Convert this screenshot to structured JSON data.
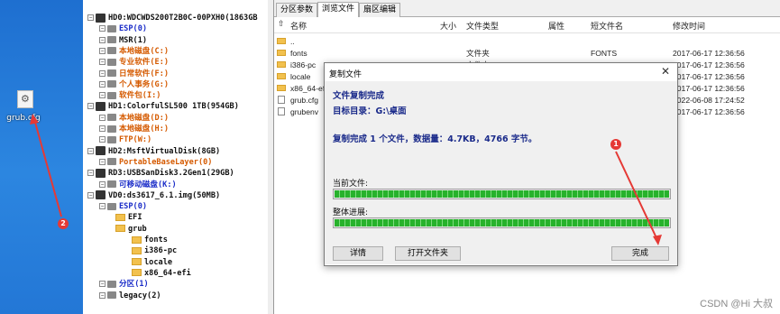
{
  "desktop": {
    "icon_label": "grub.cfg"
  },
  "tree": [
    {
      "label": "HD0:WDCWDS200T2B0C-00PXH0(1863GB",
      "color": "black",
      "level": 0,
      "kind": "disk"
    },
    {
      "label": "ESP(0)",
      "color": "blue",
      "level": 1,
      "kind": "part"
    },
    {
      "label": "MSR(1)",
      "color": "black",
      "level": 1,
      "kind": "part"
    },
    {
      "label": "本地磁盘(C:)",
      "color": "orange",
      "level": 1,
      "kind": "part"
    },
    {
      "label": "专业软件(E:)",
      "color": "orange",
      "level": 1,
      "kind": "part"
    },
    {
      "label": "日常软件(F:)",
      "color": "orange",
      "level": 1,
      "kind": "part"
    },
    {
      "label": "个人事务(G:)",
      "color": "orange",
      "level": 1,
      "kind": "part"
    },
    {
      "label": "软件包(I:)",
      "color": "orange",
      "level": 1,
      "kind": "part"
    },
    {
      "label": "HD1:ColorfulSL500 1TB(954GB)",
      "color": "black",
      "level": 0,
      "kind": "disk"
    },
    {
      "label": "本地磁盘(D:)",
      "color": "orange",
      "level": 1,
      "kind": "part"
    },
    {
      "label": "本地磁盘(H:)",
      "color": "orange",
      "level": 1,
      "kind": "part"
    },
    {
      "label": "FTP(W:)",
      "color": "orange",
      "level": 1,
      "kind": "part"
    },
    {
      "label": "HD2:MsftVirtualDisk(8GB)",
      "color": "black",
      "level": 0,
      "kind": "disk"
    },
    {
      "label": "PortableBaseLayer(0)",
      "color": "orange",
      "level": 1,
      "kind": "part"
    },
    {
      "label": "RD3:USBSanDisk3.2Gen1(29GB)",
      "color": "black",
      "level": 0,
      "kind": "disk"
    },
    {
      "label": "可移动磁盘(K:)",
      "color": "blue",
      "level": 1,
      "kind": "part"
    },
    {
      "label": "VD0:ds3617_6.1.img(50MB)",
      "color": "black",
      "level": 0,
      "kind": "disk"
    },
    {
      "label": "ESP(0)",
      "color": "blue",
      "level": 1,
      "kind": "part"
    },
    {
      "label": "EFI",
      "color": "black",
      "level": 2,
      "kind": "folder"
    },
    {
      "label": "grub",
      "color": "black",
      "level": 2,
      "kind": "folder"
    },
    {
      "label": "fonts",
      "color": "black",
      "level": 3,
      "kind": "folder"
    },
    {
      "label": "i386-pc",
      "color": "black",
      "level": 3,
      "kind": "folder"
    },
    {
      "label": "locale",
      "color": "black",
      "level": 3,
      "kind": "folder"
    },
    {
      "label": "x86_64-efi",
      "color": "black",
      "level": 3,
      "kind": "folder"
    },
    {
      "label": "分区(1)",
      "color": "blue",
      "level": 1,
      "kind": "part"
    },
    {
      "label": "legacy(2)",
      "color": "black",
      "level": 1,
      "kind": "part"
    }
  ],
  "tabs": [
    "分区参数",
    "浏览文件",
    "扇区编辑"
  ],
  "columns": {
    "name": "名称",
    "size": "大小",
    "type": "文件类型",
    "attr": "属性",
    "short": "短文件名",
    "mtime": "修改时间"
  },
  "files": [
    {
      "name": "..",
      "type": "",
      "short": "",
      "mtime": "",
      "icon": "folder"
    },
    {
      "name": "fonts",
      "type": "文件夹",
      "short": "FONTS",
      "mtime": "2017-06-17 12:36:56",
      "icon": "folder"
    },
    {
      "name": "i386-pc",
      "type": "文件夹",
      "short": "I386-PC",
      "mtime": "2017-06-17 12:36:56",
      "icon": "folder"
    },
    {
      "name": "locale",
      "type": "",
      "short": "",
      "mtime": "2017-06-17 12:36:56",
      "icon": "folder"
    },
    {
      "name": "x86_64-efi",
      "type": "",
      "short": "",
      "mtime": "2017-06-17 12:36:56",
      "icon": "folder"
    },
    {
      "name": "grub.cfg",
      "type": "",
      "short": "",
      "mtime": "2022-06-08 17:24:52",
      "icon": "doc"
    },
    {
      "name": "grubenv",
      "type": "",
      "short": "",
      "mtime": "2017-06-17 12:36:56",
      "icon": "doc"
    }
  ],
  "dialog": {
    "title": "复制文件",
    "close": "✕",
    "heading": "文件复制完成",
    "target": "目标目录：G:\\桌面",
    "summary": "复制完成 1 个文件，数据量：4.7KB，4766 字节。",
    "current_label": "当前文件:",
    "overall_label": "整体进展:",
    "current_progress": 1.0,
    "overall_progress": 1.0,
    "details_button": "详情",
    "open_folder_button": "打开文件夹",
    "finish_button": "完成"
  },
  "annotations": [
    "1",
    "2"
  ],
  "watermark": "CSDN @Hi 大叔"
}
